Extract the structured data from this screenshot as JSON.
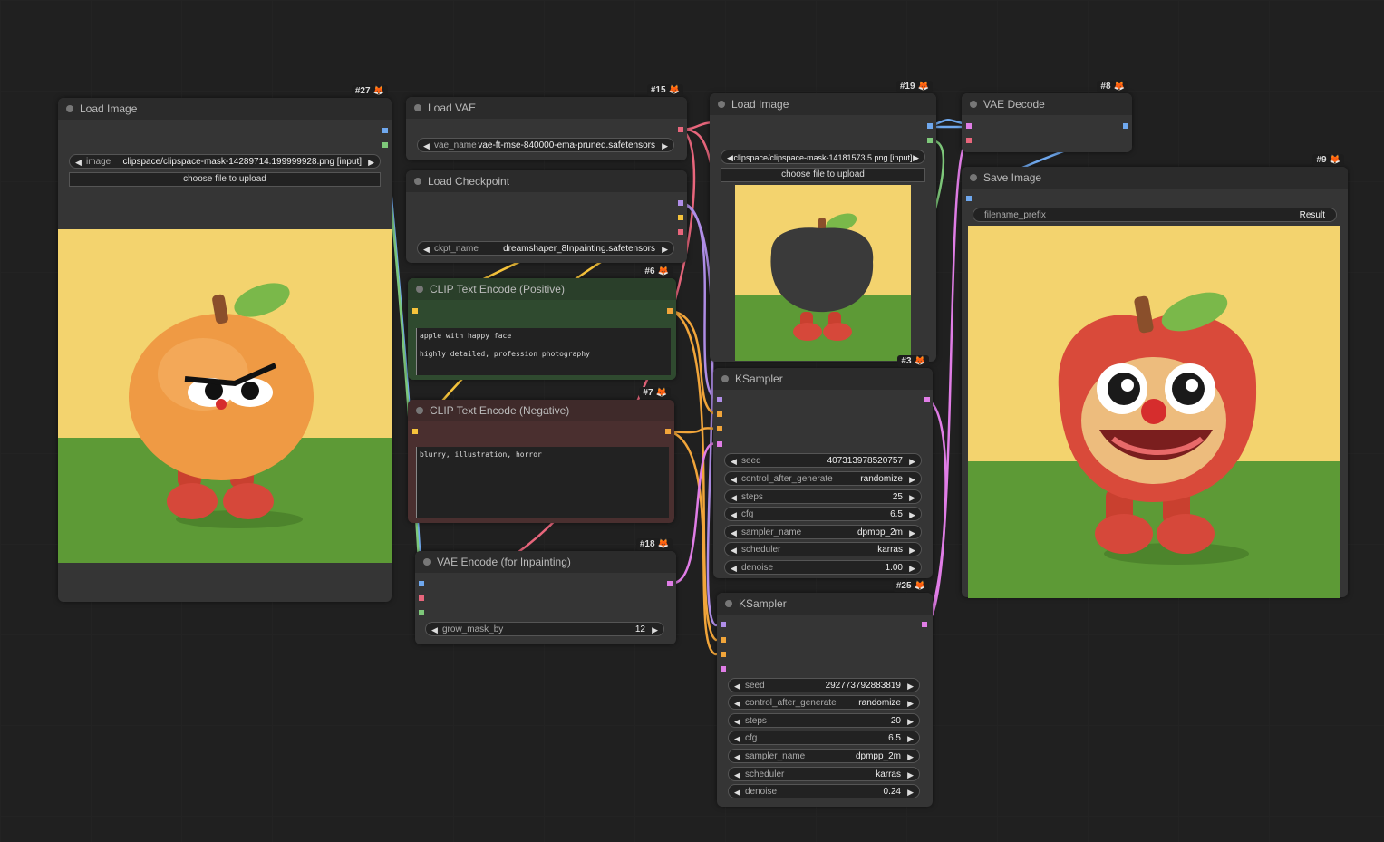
{
  "colors": {
    "clip": "#f5c33b",
    "vae": "#e8667c",
    "model": "#b08ee8",
    "latent": "#e07de6",
    "image": "#6fa8ee",
    "mask": "#7ec87a",
    "cond": "#f1a53a"
  },
  "nodes": {
    "load_image_27": {
      "id": "#27",
      "title": "Load Image",
      "image_label": "image",
      "image_value": "clipspace/clipspace-mask-14289714.199999928.png [input]",
      "upload_label": "choose file to upload"
    },
    "load_vae_15": {
      "id": "#15",
      "title": "Load VAE",
      "vae_label": "vae_name",
      "vae_value": "vae-ft-mse-840000-ema-pruned.safetensors"
    },
    "load_checkpoint": {
      "title": "Load Checkpoint",
      "ckpt_label": "ckpt_name",
      "ckpt_value": "dreamshaper_8Inpainting.safetensors"
    },
    "clip_positive_6": {
      "id": "#6",
      "title": "CLIP Text Encode (Positive)",
      "text": "apple with happy face\n\nhighly detailed, profession photography"
    },
    "clip_negative_7": {
      "id": "#7",
      "title": "CLIP Text Encode (Negative)",
      "text": "blurry, illustration, horror"
    },
    "vae_encode_18": {
      "id": "#18",
      "title": "VAE Encode (for Inpainting)",
      "grow_label": "grow_mask_by",
      "grow_value": "12"
    },
    "load_image_19": {
      "id": "#19",
      "title": "Load Image",
      "image_label": "image",
      "image_value": "clipspace/clipspace-mask-14181573.5.png [input]",
      "upload_label": "choose file to upload"
    },
    "ksampler_3": {
      "id": "#3",
      "title": "KSampler",
      "widgets": [
        {
          "label": "seed",
          "value": "407313978520757"
        },
        {
          "label": "control_after_generate",
          "value": "randomize"
        },
        {
          "label": "steps",
          "value": "25"
        },
        {
          "label": "cfg",
          "value": "6.5"
        },
        {
          "label": "sampler_name",
          "value": "dpmpp_2m"
        },
        {
          "label": "scheduler",
          "value": "karras"
        },
        {
          "label": "denoise",
          "value": "1.00"
        }
      ]
    },
    "ksampler_25": {
      "id": "#25",
      "title": "KSampler",
      "widgets": [
        {
          "label": "seed",
          "value": "292773792883819"
        },
        {
          "label": "control_after_generate",
          "value": "randomize"
        },
        {
          "label": "steps",
          "value": "20"
        },
        {
          "label": "cfg",
          "value": "6.5"
        },
        {
          "label": "sampler_name",
          "value": "dpmpp_2m"
        },
        {
          "label": "scheduler",
          "value": "karras"
        },
        {
          "label": "denoise",
          "value": "0.24"
        }
      ]
    },
    "vae_decode_8": {
      "id": "#8",
      "title": "VAE Decode"
    },
    "save_image_9": {
      "id": "#9",
      "title": "Save Image",
      "prefix_label": "filename_prefix",
      "prefix_value": "Result"
    }
  }
}
